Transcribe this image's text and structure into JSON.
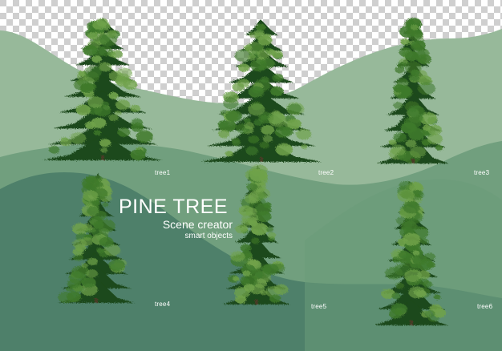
{
  "title": {
    "main": "PINE TREE",
    "subtitle": "Scene creator",
    "tagline": "smart objects"
  },
  "tree_labels": [
    "tree1",
    "tree2",
    "tree3",
    "tree4",
    "tree5",
    "tree6"
  ],
  "colors": {
    "checker_light": "#ffffff",
    "checker_dark": "#cfcfcf",
    "hill_back": "#97b99a",
    "hill_middle": "#719f7e",
    "hill_front": "#4e806a",
    "foliage_dark": "#1f4a1a",
    "foliage_mid": "#3f7a2c",
    "foliage_light": "#6fa24a",
    "label_text": "#ffffff"
  }
}
